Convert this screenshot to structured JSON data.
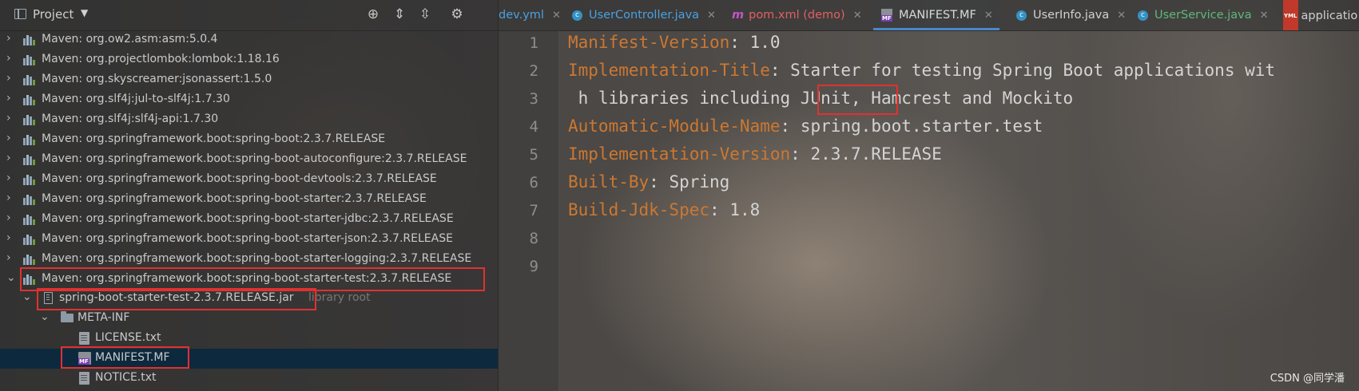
{
  "sidebar": {
    "title": "Project",
    "tools": [
      "target-icon",
      "expand-all-icon",
      "collapse-all-icon",
      "gear-icon"
    ],
    "tree": [
      {
        "label": "Maven: org.ow2.asm:asm:5.0.4",
        "expanded": false
      },
      {
        "label": "Maven: org.projectlombok:lombok:1.18.16",
        "expanded": false
      },
      {
        "label": "Maven: org.skyscreamer:jsonassert:1.5.0",
        "expanded": false
      },
      {
        "label": "Maven: org.slf4j:jul-to-slf4j:1.7.30",
        "expanded": false
      },
      {
        "label": "Maven: org.slf4j:slf4j-api:1.7.30",
        "expanded": false
      },
      {
        "label": "Maven: org.springframework.boot:spring-boot:2.3.7.RELEASE",
        "expanded": false
      },
      {
        "label": "Maven: org.springframework.boot:spring-boot-autoconfigure:2.3.7.RELEASE",
        "expanded": false
      },
      {
        "label": "Maven: org.springframework.boot:spring-boot-devtools:2.3.7.RELEASE",
        "expanded": false
      },
      {
        "label": "Maven: org.springframework.boot:spring-boot-starter:2.3.7.RELEASE",
        "expanded": false
      },
      {
        "label": "Maven: org.springframework.boot:spring-boot-starter-jdbc:2.3.7.RELEASE",
        "expanded": false
      },
      {
        "label": "Maven: org.springframework.boot:spring-boot-starter-json:2.3.7.RELEASE",
        "expanded": false
      },
      {
        "label": "Maven: org.springframework.boot:spring-boot-starter-logging:2.3.7.RELEASE",
        "expanded": false
      },
      {
        "label": "Maven: org.springframework.boot:spring-boot-starter-test:2.3.7.RELEASE",
        "expanded": true
      }
    ],
    "jar": {
      "label": "spring-boot-starter-test-2.3.7.RELEASE.jar",
      "suffix": "library root"
    },
    "meta_inf": "META-INF",
    "files": [
      "LICENSE.txt",
      "MANIFEST.MF",
      "NOTICE.txt"
    ],
    "selected_file": "MANIFEST.MF"
  },
  "tabs": [
    {
      "label": "dev.yml",
      "color": "#4aa0e0"
    },
    {
      "label": "UserController.java",
      "color": "#4aa0e0"
    },
    {
      "label": "pom.xml (demo)",
      "color": "#e06060"
    },
    {
      "label": "MANIFEST.MF",
      "color": "#d0d0d0",
      "active": true
    },
    {
      "label": "UserInfo.java",
      "color": "#d0d0d0"
    },
    {
      "label": "UserService.java",
      "color": "#5fb87a"
    },
    {
      "label": "applicatio",
      "color": "#d0d0d0"
    }
  ],
  "editor": {
    "line_numbers": [
      "1",
      "2",
      "3",
      "4",
      "5",
      "6",
      "7",
      "8",
      "9"
    ],
    "lines": [
      {
        "key": "Manifest-Version",
        "sep": ": ",
        "value": "1.0"
      },
      {
        "key": "Implementation-Title",
        "sep": ": ",
        "value": "Starter for testing Spring Boot applications wit"
      },
      {
        "key": "",
        "sep": "",
        "value": " h libraries including ",
        "highlight": "JUnit,",
        "rest": " Hamcrest and Mockito"
      },
      {
        "key": "Automatic-Module-Name",
        "sep": ": ",
        "value": "spring.boot.starter.test"
      },
      {
        "key": "Implementation-Version",
        "sep": ": ",
        "value": "2.3.7.RELEASE"
      },
      {
        "key": "Built-By",
        "sep": ": ",
        "value": "Spring"
      },
      {
        "key": "Build-Jdk-Spec",
        "sep": ": ",
        "value": "1.8"
      }
    ]
  },
  "watermark": "CSDN @同学潘",
  "colors": {
    "highlight_box": "#e03131",
    "key": "#cc7832",
    "selection": "#0d293e"
  }
}
